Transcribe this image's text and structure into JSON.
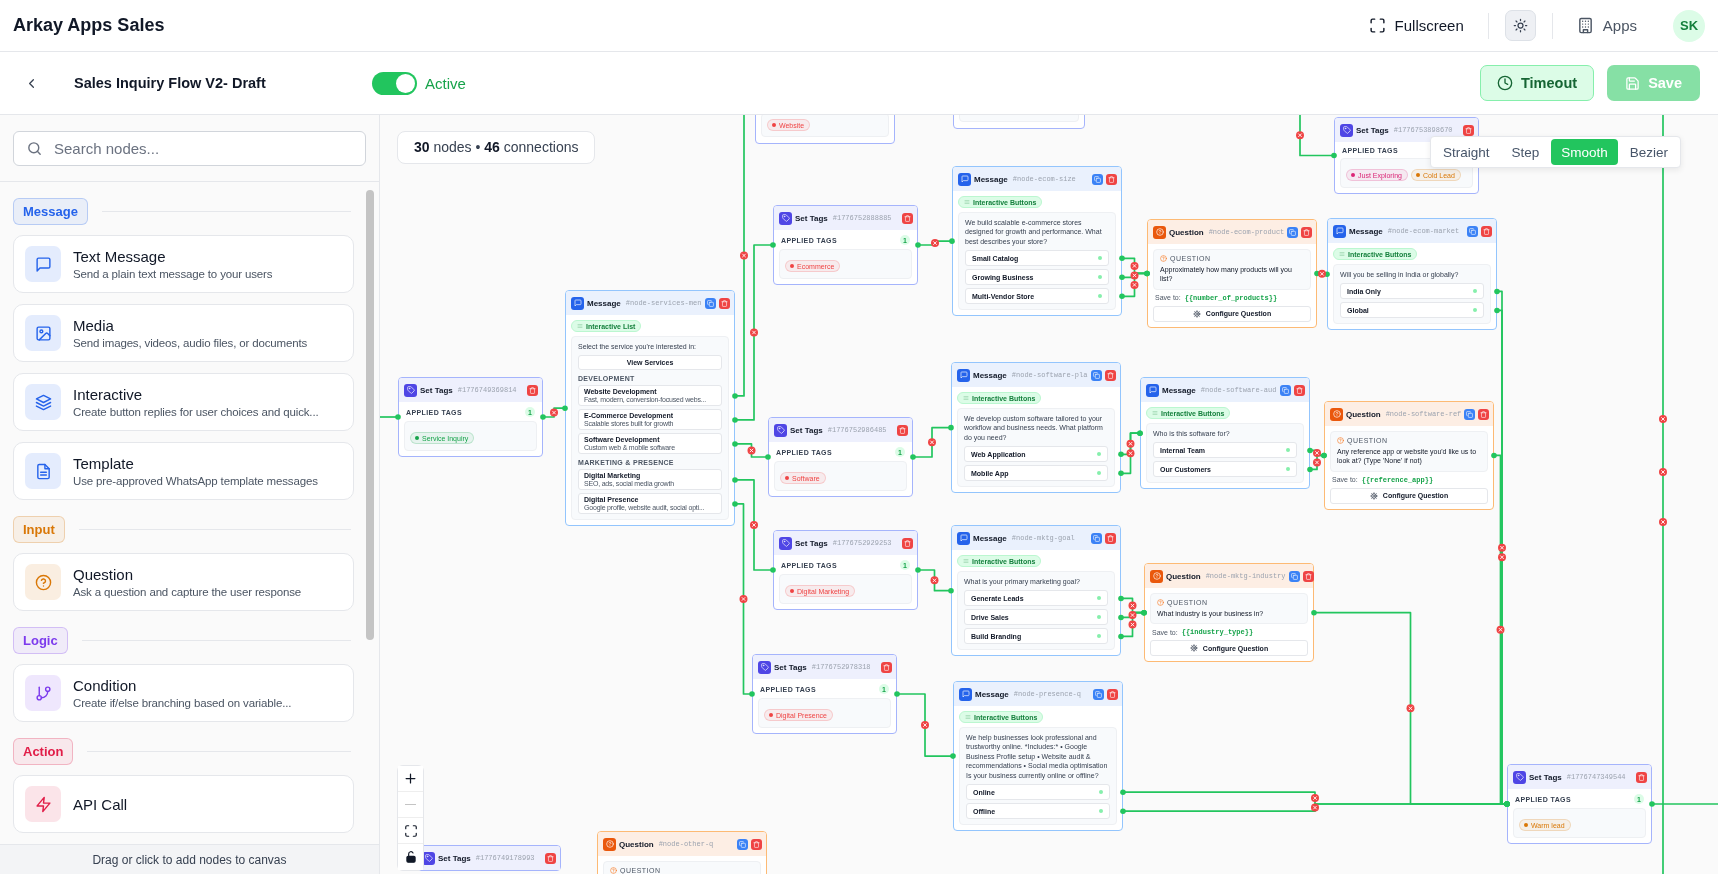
{
  "header": {
    "title": "Arkay Apps Sales",
    "fullscreen": "Fullscreen",
    "apps": "Apps",
    "avatar": "SK"
  },
  "toolbar": {
    "flow_name": "Sales Inquiry Flow V2- Draft",
    "status": {
      "label": "Active",
      "on": true
    },
    "timeout": "Timeout",
    "save": {
      "label": "Save",
      "disabled": true
    }
  },
  "sidebar": {
    "search": {
      "placeholder": "Search nodes..."
    },
    "groups": [
      {
        "label": "Message",
        "color": "#2563eb",
        "items": [
          {
            "title": "Text Message",
            "description": "Send a plain text message to your users"
          },
          {
            "title": "Media",
            "description": "Send images, videos, audio files, or documents"
          },
          {
            "title": "Interactive",
            "description": "Create button replies for user choices and quick..."
          },
          {
            "title": "Template",
            "description": "Use pre-approved WhatsApp template messages"
          }
        ]
      },
      {
        "label": "Input",
        "color": "#d97706",
        "items": [
          {
            "title": "Question",
            "description": "Ask a question and capture the user response"
          }
        ]
      },
      {
        "label": "Logic",
        "color": "#7c3aed",
        "items": [
          {
            "title": "Condition",
            "description": "Create if/else branching based on variable..."
          }
        ]
      },
      {
        "label": "Action",
        "color": "#e11d48",
        "items": [
          {
            "title": "API Call"
          }
        ]
      }
    ],
    "footer": "Drag or click to add nodes to canvas"
  },
  "canvas": {
    "stats": "**30** nodes • **46** connections",
    "edge_styles": [
      {
        "label": "Straight",
        "selected": false
      },
      {
        "label": "Step",
        "selected": false
      },
      {
        "label": "Smooth",
        "selected": true
      },
      {
        "label": "Bezier",
        "selected": false
      }
    ],
    "nodes": [
      {
        "kind": "fragment",
        "tags": [
          {
            "label": "Website",
            "color": "#ef4444"
          }
        ]
      },
      {
        "kind": "fragment"
      },
      {
        "kind": "set_tags",
        "title": "Set Tags",
        "id_label": "#1776753898670",
        "section_label": "APPLIED TAGS",
        "tags": [
          {
            "label": "Just Exploring",
            "color": "#db2777"
          },
          {
            "label": "Cold Lead",
            "color": "#d97706"
          }
        ]
      },
      {
        "kind": "set_tags",
        "title": "Set Tags",
        "id_label": "#1776749369814",
        "section_label": "APPLIED TAGS",
        "count": "1",
        "tags": [
          {
            "label": "Service Inquiry",
            "color": "#16a34a"
          }
        ]
      },
      {
        "kind": "message",
        "title": "Message",
        "id_label": "#node-services-men",
        "badge": "Interactive List",
        "body": "Select the service you're interested in:",
        "list_button": "View Services",
        "sections": [
          {
            "title": "DEVELOPMENT",
            "rows": [
              {
                "title": "Website Development",
                "description": "Fast, modern, conversion-focused webs..."
              },
              {
                "title": "E-Commerce Development",
                "description": "Scalable stores built for growth"
              },
              {
                "title": "Software Development",
                "description": "Custom web & mobile software"
              }
            ]
          },
          {
            "title": "MARKETING & PRESENCE",
            "rows": [
              {
                "title": "Digital Marketing",
                "description": "SEO, ads, social media growth"
              },
              {
                "title": "Digital Presence",
                "description": "Google profile, website audit, social opti..."
              }
            ]
          }
        ]
      },
      {
        "kind": "set_tags",
        "title": "Set Tags",
        "id_label": "#1776752888885",
        "section_label": "APPLIED TAGS",
        "count": "1",
        "tags": [
          {
            "label": "Ecommerce",
            "color": "#ef4444"
          }
        ]
      },
      {
        "kind": "message",
        "title": "Message",
        "id_label": "#node-ecom-size",
        "badge": "Interactive Buttons",
        "body": "We build scalable e-commerce stores designed for growth and performance. What best describes your store?",
        "buttons": [
          "Small Catalog",
          "Growing Business",
          "Multi-Vendor Store"
        ]
      },
      {
        "kind": "question",
        "title": "Question",
        "id_label": "#node-ecom-product",
        "section_label": "QUESTION",
        "text": "Approximately how many products will you list?",
        "save_label": "Save to:",
        "variable": "{{number_of_products}}",
        "action": "Configure Question"
      },
      {
        "kind": "message",
        "title": "Message",
        "id_label": "#node-ecom-market",
        "badge": "Interactive Buttons",
        "body": "Will you be selling in India or globally?",
        "buttons": [
          "India Only",
          "Global"
        ]
      },
      {
        "kind": "set_tags",
        "title": "Set Tags",
        "id_label": "#1776752986485",
        "section_label": "APPLIED TAGS",
        "count": "1",
        "tags": [
          {
            "label": "Software",
            "color": "#ef4444"
          }
        ]
      },
      {
        "kind": "message",
        "title": "Message",
        "id_label": "#node-software-pla",
        "badge": "Interactive Buttons",
        "body": "We develop custom software tailored to your workflow and business needs. What platform do you need?",
        "buttons": [
          "Web Application",
          "Mobile App"
        ]
      },
      {
        "kind": "message",
        "title": "Message",
        "id_label": "#node-software-aud",
        "badge": "Interactive Buttons",
        "body": "Who is this software for?",
        "buttons": [
          "Internal Team",
          "Our Customers"
        ]
      },
      {
        "kind": "question",
        "title": "Question",
        "id_label": "#node-software-ref",
        "section_label": "QUESTION",
        "text": "Any reference app or website you'd like us to look at? (Type 'None' if not)",
        "save_label": "Save to:",
        "variable": "{{reference_app}}",
        "action": "Configure Question"
      },
      {
        "kind": "set_tags",
        "title": "Set Tags",
        "id_label": "#1776752929253",
        "section_label": "APPLIED TAGS",
        "count": "1",
        "tags": [
          {
            "label": "Digital Marketing",
            "color": "#ef4444"
          }
        ]
      },
      {
        "kind": "message",
        "title": "Message",
        "id_label": "#node-mktg-goal",
        "badge": "Interactive Buttons",
        "body": "What is your primary marketing goal?",
        "buttons": [
          "Generate Leads",
          "Drive Sales",
          "Build Branding"
        ]
      },
      {
        "kind": "question",
        "title": "Question",
        "id_label": "#node-mktg-industry",
        "section_label": "QUESTION",
        "text": "What industry is your business in?",
        "save_label": "Save to:",
        "variable": "{{industry_type}}",
        "action": "Configure Question"
      },
      {
        "kind": "set_tags",
        "title": "Set Tags",
        "id_label": "#1776752978318",
        "section_label": "APPLIED TAGS",
        "count": "1",
        "tags": [
          {
            "label": "Digital Presence",
            "color": "#ef4444"
          }
        ]
      },
      {
        "kind": "message",
        "title": "Message",
        "id_label": "#node-presence-q",
        "badge": "Interactive Buttons",
        "body": "We help businesses look professional and trustworthy online. *Includes:* • Google Business Profile setup • Website audit & recommendations • Social media optimisation Is your business currently online or offline?",
        "buttons": [
          "Online",
          "Offline"
        ]
      },
      {
        "kind": "set_tags",
        "title": "Set Tags",
        "id_label": "#1776747349544",
        "section_label": "APPLIED TAGS",
        "count": "1",
        "tags": [
          {
            "label": "Warm lead",
            "color": "#d97706"
          }
        ]
      },
      {
        "kind": "set_tags",
        "title": "Set Tags",
        "id_label": "#1776749178993"
      },
      {
        "kind": "question",
        "title": "Question",
        "id_label": "#node-other-q",
        "section_label": "QUESTION"
      }
    ]
  }
}
